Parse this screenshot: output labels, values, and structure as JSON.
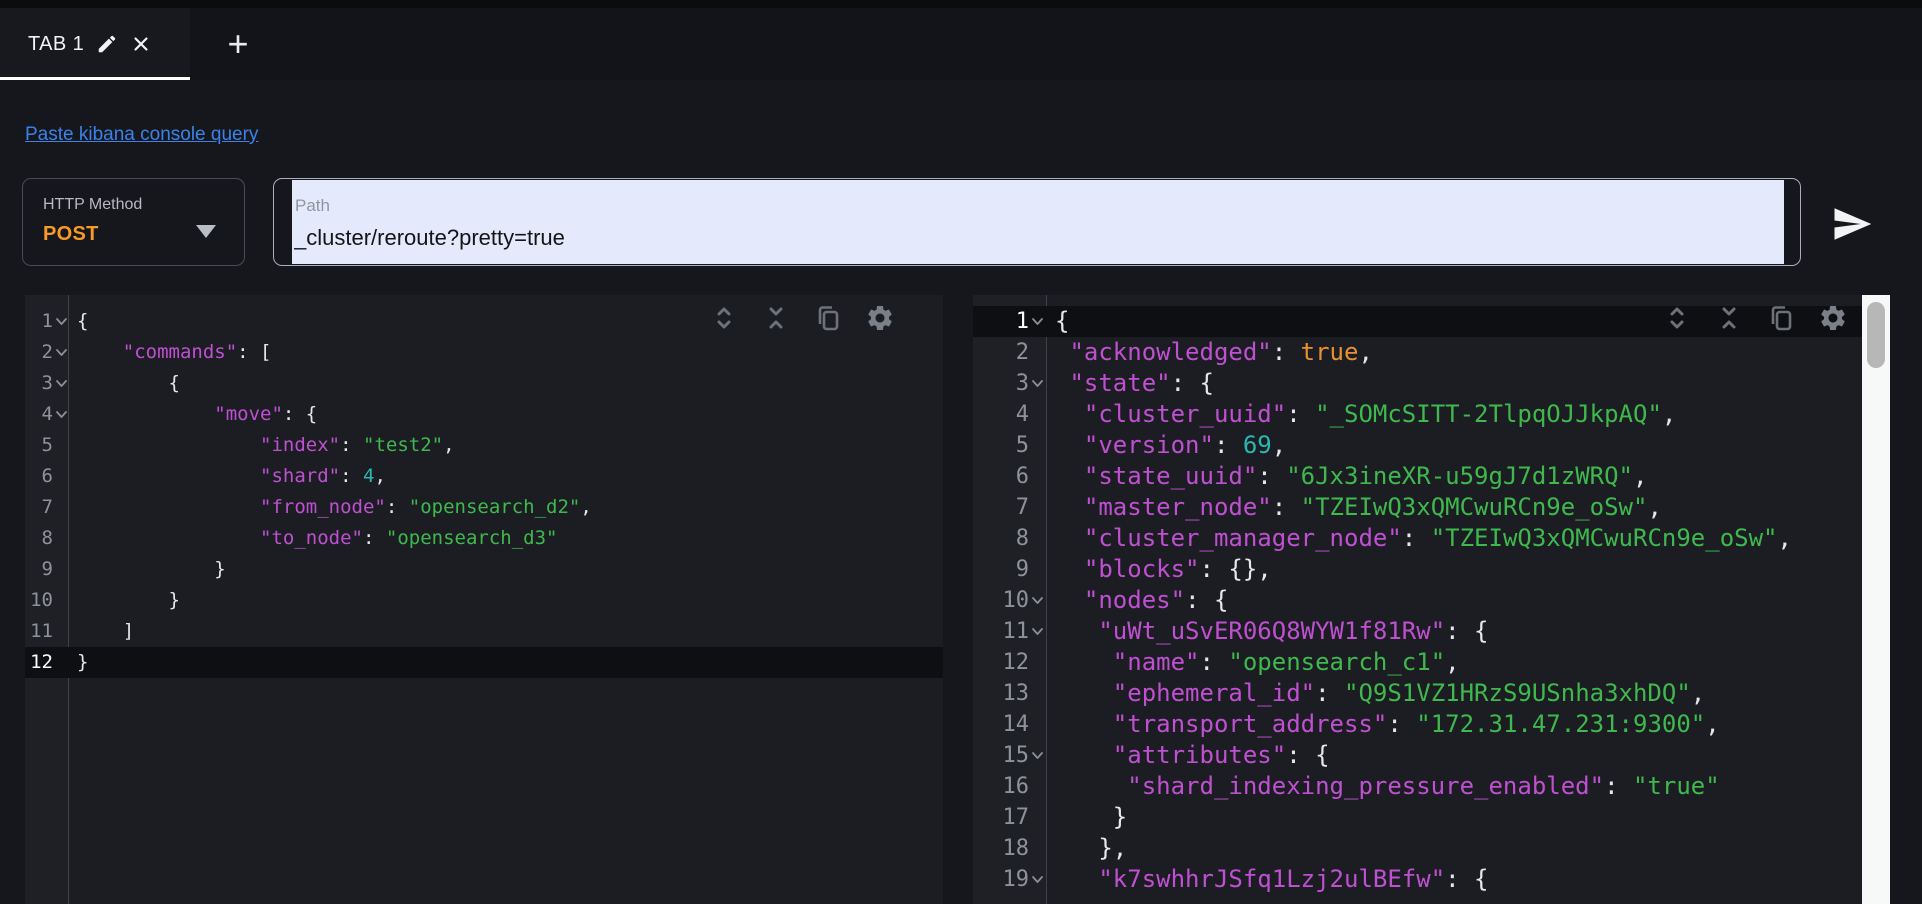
{
  "tab_bar": {
    "tabs": [
      {
        "label": "TAB 1",
        "active": true
      }
    ],
    "new_tab_label": "+"
  },
  "toolbar_link": {
    "label": "Paste kibana console query"
  },
  "request_controls": {
    "method_label": "HTTP Method",
    "method_value": "POST",
    "path_label": "Path",
    "path_value": "_cluster/reroute?pretty=true"
  },
  "colors": {
    "accent_orange": "#f79a28",
    "link_blue": "#3b82e8",
    "syntax_key": "#c050d2",
    "syntax_string": "#3fb94e",
    "syntax_number": "#2ab7b4",
    "syntax_boolean": "#e8922f",
    "code_default": "#e6e7ea",
    "editor_bg": "#1b1d22",
    "gutter_bg": "#1e2025",
    "active_line_bg": "#0d0f13",
    "path_field_bg": "#e4eafb"
  },
  "request_editor": {
    "lines": [
      {
        "n": 1,
        "fold": true,
        "indent": 0,
        "seg": [
          [
            "d",
            "{"
          ]
        ]
      },
      {
        "n": 2,
        "fold": true,
        "indent": 4,
        "seg": [
          [
            "k",
            "\"commands\""
          ],
          [
            "d",
            ": ["
          ]
        ]
      },
      {
        "n": 3,
        "fold": true,
        "indent": 8,
        "seg": [
          [
            "d",
            "{"
          ]
        ]
      },
      {
        "n": 4,
        "fold": true,
        "indent": 12,
        "seg": [
          [
            "k",
            "\"move\""
          ],
          [
            "d",
            ": {"
          ]
        ]
      },
      {
        "n": 5,
        "indent": 16,
        "seg": [
          [
            "k",
            "\"index\""
          ],
          [
            "d",
            ": "
          ],
          [
            "s",
            "\"test2\""
          ],
          [
            "d",
            ","
          ]
        ]
      },
      {
        "n": 6,
        "indent": 16,
        "seg": [
          [
            "k",
            "\"shard\""
          ],
          [
            "d",
            ": "
          ],
          [
            "n",
            "4"
          ],
          [
            "d",
            ","
          ]
        ]
      },
      {
        "n": 7,
        "indent": 16,
        "seg": [
          [
            "k",
            "\"from_node\""
          ],
          [
            "d",
            ": "
          ],
          [
            "s",
            "\"opensearch_d2\""
          ],
          [
            "d",
            ","
          ]
        ]
      },
      {
        "n": 8,
        "indent": 16,
        "seg": [
          [
            "k",
            "\"to_node\""
          ],
          [
            "d",
            ": "
          ],
          [
            "s",
            "\"opensearch_d3\""
          ]
        ]
      },
      {
        "n": 9,
        "indent": 12,
        "seg": [
          [
            "d",
            "}"
          ]
        ]
      },
      {
        "n": 10,
        "indent": 8,
        "seg": [
          [
            "d",
            "}"
          ]
        ]
      },
      {
        "n": 11,
        "indent": 4,
        "seg": [
          [
            "d",
            "]"
          ]
        ]
      },
      {
        "n": 12,
        "active": true,
        "indent": 0,
        "seg": [
          [
            "d",
            "}"
          ]
        ]
      }
    ]
  },
  "response_editor": {
    "lines": [
      {
        "n": 1,
        "fold": true,
        "active": true,
        "indent": 0,
        "seg": [
          [
            "d",
            "{"
          ]
        ]
      },
      {
        "n": 2,
        "indent": 1,
        "seg": [
          [
            "k",
            "\"acknowledged\""
          ],
          [
            "d",
            ": "
          ],
          [
            "b",
            "true"
          ],
          [
            "d",
            ","
          ]
        ]
      },
      {
        "n": 3,
        "fold": true,
        "indent": 1,
        "seg": [
          [
            "k",
            "\"state\""
          ],
          [
            "d",
            ": {"
          ]
        ]
      },
      {
        "n": 4,
        "indent": 2,
        "seg": [
          [
            "k",
            "\"cluster_uuid\""
          ],
          [
            "d",
            ": "
          ],
          [
            "s",
            "\"_SOMcSITT-2TlpqOJJkpAQ\""
          ],
          [
            "d",
            ","
          ]
        ]
      },
      {
        "n": 5,
        "indent": 2,
        "seg": [
          [
            "k",
            "\"version\""
          ],
          [
            "d",
            ": "
          ],
          [
            "n",
            "69"
          ],
          [
            "d",
            ","
          ]
        ]
      },
      {
        "n": 6,
        "indent": 2,
        "seg": [
          [
            "k",
            "\"state_uuid\""
          ],
          [
            "d",
            ": "
          ],
          [
            "s",
            "\"6Jx3ineXR-u59gJ7d1zWRQ\""
          ],
          [
            "d",
            ","
          ]
        ]
      },
      {
        "n": 7,
        "indent": 2,
        "seg": [
          [
            "k",
            "\"master_node\""
          ],
          [
            "d",
            ": "
          ],
          [
            "s",
            "\"TZEIwQ3xQMCwuRCn9e_oSw\""
          ],
          [
            "d",
            ","
          ]
        ]
      },
      {
        "n": 8,
        "indent": 2,
        "seg": [
          [
            "k",
            "\"cluster_manager_node\""
          ],
          [
            "d",
            ": "
          ],
          [
            "s",
            "\"TZEIwQ3xQMCwuRCn9e_oSw\""
          ],
          [
            "d",
            ","
          ]
        ]
      },
      {
        "n": 9,
        "indent": 2,
        "seg": [
          [
            "k",
            "\"blocks\""
          ],
          [
            "d",
            ": {},"
          ]
        ]
      },
      {
        "n": 10,
        "fold": true,
        "indent": 2,
        "seg": [
          [
            "k",
            "\"nodes\""
          ],
          [
            "d",
            ": {"
          ]
        ]
      },
      {
        "n": 11,
        "fold": true,
        "indent": 3,
        "seg": [
          [
            "k",
            "\"uWt_uSvER06Q8WYW1f81Rw\""
          ],
          [
            "d",
            ": {"
          ]
        ]
      },
      {
        "n": 12,
        "indent": 4,
        "seg": [
          [
            "k",
            "\"name\""
          ],
          [
            "d",
            ": "
          ],
          [
            "s",
            "\"opensearch_c1\""
          ],
          [
            "d",
            ","
          ]
        ]
      },
      {
        "n": 13,
        "indent": 4,
        "seg": [
          [
            "k",
            "\"ephemeral_id\""
          ],
          [
            "d",
            ": "
          ],
          [
            "s",
            "\"Q9S1VZ1HRzS9USnha3xhDQ\""
          ],
          [
            "d",
            ","
          ]
        ]
      },
      {
        "n": 14,
        "indent": 4,
        "seg": [
          [
            "k",
            "\"transport_address\""
          ],
          [
            "d",
            ": "
          ],
          [
            "s",
            "\"172.31.47.231:9300\""
          ],
          [
            "d",
            ","
          ]
        ]
      },
      {
        "n": 15,
        "fold": true,
        "indent": 4,
        "seg": [
          [
            "k",
            "\"attributes\""
          ],
          [
            "d",
            ": {"
          ]
        ]
      },
      {
        "n": 16,
        "indent": 5,
        "seg": [
          [
            "k",
            "\"shard_indexing_pressure_enabled\""
          ],
          [
            "d",
            ": "
          ],
          [
            "s",
            "\"true\""
          ]
        ]
      },
      {
        "n": 17,
        "indent": 4,
        "seg": [
          [
            "d",
            "}"
          ]
        ]
      },
      {
        "n": 18,
        "indent": 3,
        "seg": [
          [
            "d",
            "},"
          ]
        ]
      },
      {
        "n": 19,
        "fold": true,
        "indent": 3,
        "seg": [
          [
            "k",
            "\"k7swhhrJSfq1Lzj2ulBEfw\""
          ],
          [
            "d",
            ": {"
          ]
        ]
      }
    ]
  }
}
